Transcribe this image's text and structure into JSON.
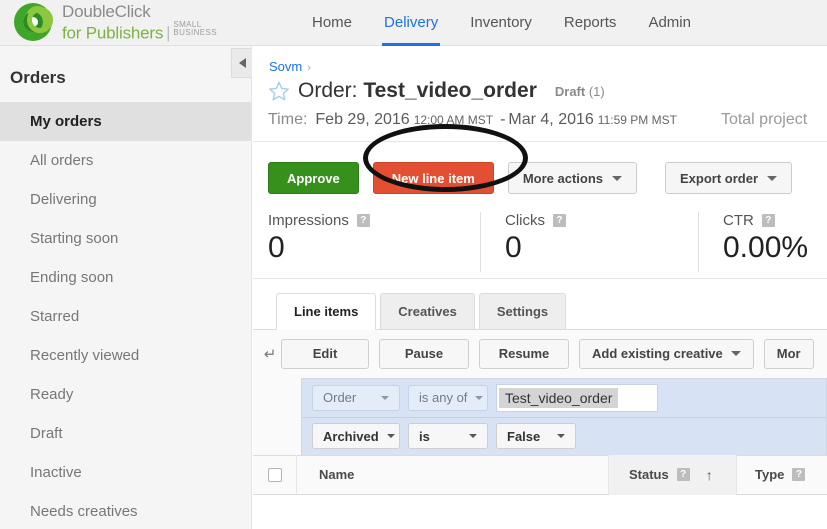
{
  "brand": {
    "line1": "DoubleClick",
    "line2": "for Publishers",
    "separator": "|",
    "badge_line1": "SMALL",
    "badge_line2": "BUSINESS",
    "accent_green": "#7cb342"
  },
  "nav": {
    "items": [
      {
        "label": "Home",
        "active": false
      },
      {
        "label": "Delivery",
        "active": true
      },
      {
        "label": "Inventory",
        "active": false
      },
      {
        "label": "Reports",
        "active": false
      },
      {
        "label": "Admin",
        "active": false
      }
    ],
    "active_color": "#1a73e8"
  },
  "sidebar": {
    "title": "Orders",
    "items": [
      {
        "label": "My orders",
        "selected": true
      },
      {
        "label": "All orders",
        "selected": false
      },
      {
        "label": "Delivering",
        "selected": false
      },
      {
        "label": "Starting soon",
        "selected": false
      },
      {
        "label": "Ending soon",
        "selected": false
      },
      {
        "label": "Starred",
        "selected": false
      },
      {
        "label": "Recently viewed",
        "selected": false
      },
      {
        "label": "Ready",
        "selected": false
      },
      {
        "label": "Draft",
        "selected": false
      },
      {
        "label": "Inactive",
        "selected": false
      },
      {
        "label": "Needs creatives",
        "selected": false
      }
    ]
  },
  "breadcrumb": {
    "parent": "Sovm",
    "caret": "›"
  },
  "order": {
    "label": "Order:",
    "name": "Test_video_order",
    "status": "Draft",
    "status_count": "(1)",
    "time_label": "Time:",
    "start_date": "Feb 29, 2016",
    "start_time": "12:00 AM MST",
    "dash": "-",
    "end_date": "Mar 4, 2016",
    "end_time": "11:59 PM MST",
    "total_projected": "Total project"
  },
  "actions": {
    "approve": "Approve",
    "new_line_item": "New line item",
    "more_actions": "More actions",
    "export_order": "Export order",
    "approve_color": "#38901c",
    "new_line_item_color": "#e34f33",
    "annotation_shape": "ellipse-highlight"
  },
  "metrics": [
    {
      "label": "Impressions",
      "value": "0",
      "help": "?"
    },
    {
      "label": "Clicks",
      "value": "0",
      "help": "?"
    },
    {
      "label": "CTR",
      "value": "0.00%",
      "help": "?"
    }
  ],
  "tabs": [
    {
      "label": "Line items",
      "active": true
    },
    {
      "label": "Creatives",
      "active": false
    },
    {
      "label": "Settings",
      "active": false
    }
  ],
  "toolbar": {
    "undo_icon": "↵",
    "edit": "Edit",
    "pause": "Pause",
    "resume": "Resume",
    "add_existing_creative": "Add existing creative",
    "more": "Mor"
  },
  "filters": [
    {
      "field": "Order",
      "operator": "is any of",
      "value_chip": "Test_video_order",
      "style": "light"
    },
    {
      "field": "Archived",
      "operator": "is",
      "value": "False",
      "style": "solid"
    }
  ],
  "table": {
    "columns": [
      {
        "label": "Name",
        "help": null,
        "sorted": false
      },
      {
        "label": "Status",
        "help": "?",
        "sorted": true,
        "sort_arrow": "↑"
      },
      {
        "label": "Type",
        "help": "?",
        "sorted": false
      }
    ]
  }
}
